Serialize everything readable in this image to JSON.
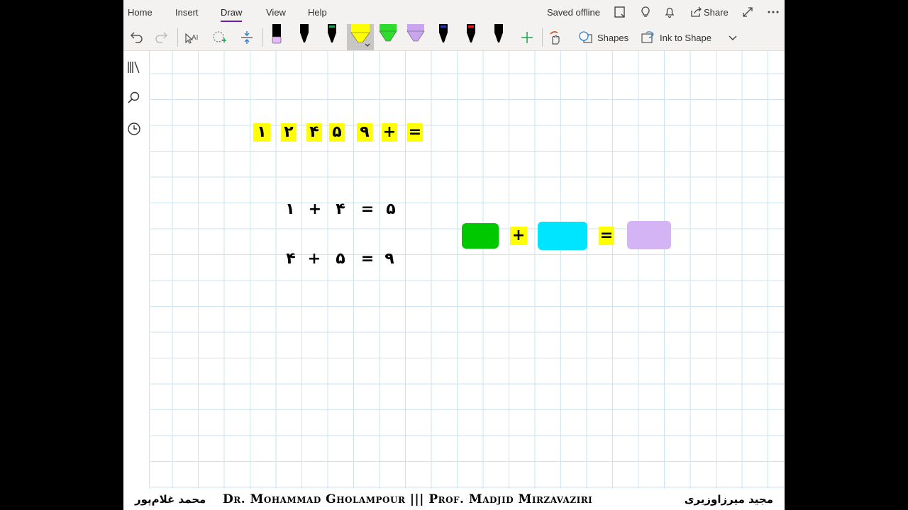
{
  "tabs": [
    {
      "label": "Home"
    },
    {
      "label": "Insert"
    },
    {
      "label": "Draw"
    },
    {
      "label": "View"
    },
    {
      "label": "Help"
    }
  ],
  "status": "Saved offline",
  "share_label": "Share",
  "toolbar": {
    "shapes_label": "Shapes",
    "ink_to_shape_label": "Ink to Shape",
    "pen_colors": [
      "#e8b8ff",
      "#000000",
      "#1aa84b",
      "#ffff00",
      "#2ddc2d",
      "#c9a5f0",
      "#1e3fa8",
      "#e02020",
      "#000000"
    ]
  },
  "canvas": {
    "top_row": [
      "١",
      "٢",
      "۴",
      "۵",
      "٩",
      "+",
      "="
    ],
    "eq1": {
      "a": "١",
      "op": "+",
      "b": "۴",
      "eq": "=",
      "result": "۵"
    },
    "eq2": {
      "a": "۴",
      "op": "+",
      "b": "۵",
      "eq": "=",
      "result": "٩"
    },
    "shape_eq": {
      "op": "+",
      "eq": "=",
      "colors": [
        "#00c800",
        "#00e5ff",
        "#d4b4f5"
      ]
    }
  },
  "footer": {
    "left": "محمد غلام‌پور",
    "center": "Dr. Mohammad Gholampour ||| Prof. Madjid Mirzavaziri",
    "right": "مجید میرزاوزیری"
  }
}
